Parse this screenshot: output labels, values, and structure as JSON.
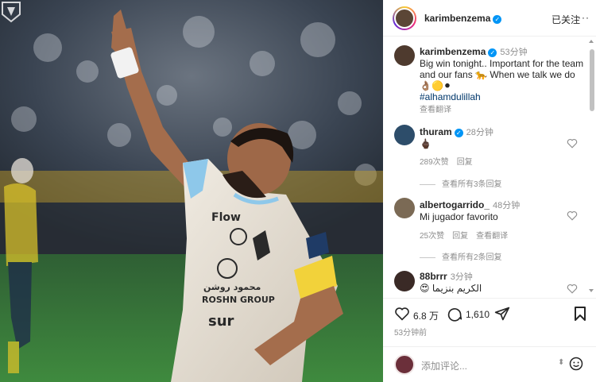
{
  "colors": {
    "accent": "#0095f6",
    "hashtag": "#00376b",
    "muted": "#8e8e8e"
  },
  "header": {
    "username": "karimbenzema",
    "follow_label": "已关注",
    "more_icon": "more-icon"
  },
  "caption": {
    "username": "karimbenzema",
    "time": "53分钟",
    "text": "Big win tonight.. Important for the team and our fans 🐆 When we talk we do 👌🏽🟡⚫",
    "hashtag": "#alhamdulillah",
    "translate": "查看翻译"
  },
  "comments": [
    {
      "username": "thuram",
      "verified": true,
      "time": "28分钟",
      "text": "🖕🏿",
      "likes": "289次赞",
      "reply": "回复",
      "translate": "",
      "view_replies": "查看所有3条回复"
    },
    {
      "username": "albertogarrido_",
      "verified": false,
      "time": "48分钟",
      "text": "Mi jugador favorito",
      "likes": "25次赞",
      "reply": "回复",
      "translate": "查看翻译",
      "view_replies": "查看所有2条回复"
    },
    {
      "username": "88brrr",
      "verified": false,
      "time": "3分钟",
      "text": "😍 الكريم بنزيما",
      "likes": "",
      "reply": "",
      "translate": "",
      "view_replies": ""
    }
  ],
  "actions": {
    "likes_count": "6.8 万",
    "comments_count": "1,610",
    "posted_time": "53分钟前"
  },
  "comment_box": {
    "placeholder": "添加评论..."
  }
}
